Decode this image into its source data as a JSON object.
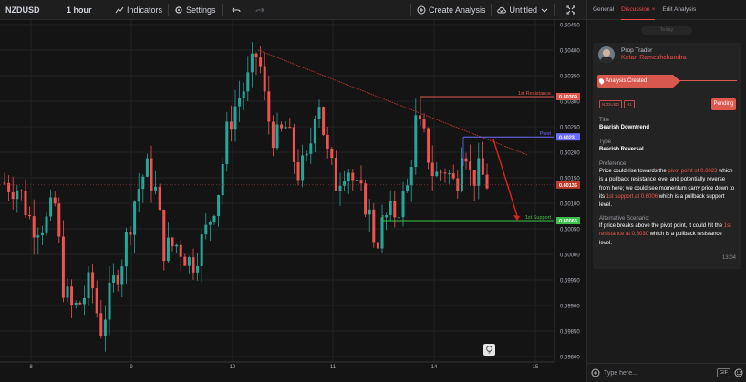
{
  "toolbar": {
    "symbol": "NZDUSD",
    "interval": "1 hour",
    "indicators": "Indicators",
    "settings": "Settings",
    "create_analysis": "Create Analysis",
    "layout_name": "Untitled"
  },
  "panel": {
    "tabs": [
      "General",
      "Discussion",
      "Edit Analysis"
    ],
    "active_tab": "Discussion",
    "day_label": "Today",
    "card": {
      "role": "Prop Trader",
      "author": "Ketan Rameshchandra",
      "event": "Analysis Created",
      "tags": [
        "NZDUSD",
        "H1"
      ],
      "status": "Pending",
      "title_label": "Title",
      "title": "Bearish Downtrend",
      "type_label": "Type",
      "type": "Bearish Reversal",
      "preference_label": "Preference:",
      "preference_parts": [
        "Price could rise towards the ",
        "pivot point of 0.6023",
        " which is a pullback resistance level and potentially reverse from here; we could see momentum carry price down to its ",
        "1st support at 0.6006",
        " which is a pullback support level."
      ],
      "alternative_label": "Alternative Scenario:",
      "alternative_parts": [
        "If price breaks above the pivot point, it could hit the ",
        "1st resistance at 0.6030",
        " which is a pullback resistance level."
      ],
      "time": "13:04"
    },
    "input_placeholder": "Type here...",
    "gif_label": "GIF"
  },
  "chart_data": {
    "type": "candlestick",
    "symbol": "NZDUSD",
    "timeframe": "1h",
    "x_ticks": [
      "8",
      "9",
      "10",
      "11",
      "14",
      "15"
    ],
    "y_ticks": [
      "0.60450",
      "0.60400",
      "0.60350",
      "0.60300",
      "0.60250",
      "0.60200",
      "0.60150",
      "0.60100",
      "0.60050",
      "0.60000",
      "0.59950",
      "0.59900",
      "0.59850",
      "0.59800"
    ],
    "y_range": [
      0.598,
      0.6045
    ],
    "current_price": "0.60136",
    "levels": [
      {
        "name": "1st Resistance",
        "value": "0.60309",
        "color": "#e0574d"
      },
      {
        "name": "Pivot",
        "value": "0.6023",
        "color": "#6b6bff"
      },
      {
        "name": "1st Support",
        "value": "0.60066",
        "color": "#3fc24a"
      }
    ],
    "colors": {
      "up": "#26a69a",
      "down": "#ef5350"
    }
  }
}
